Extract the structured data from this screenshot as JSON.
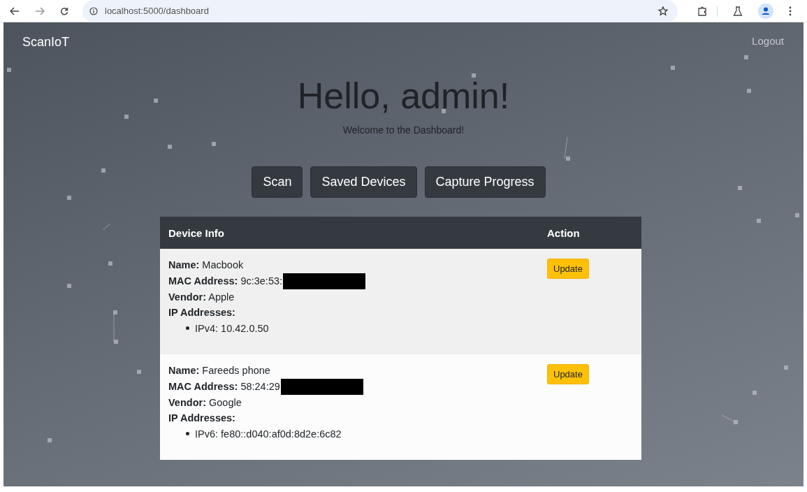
{
  "browser": {
    "url": "localhost:5000/dashboard"
  },
  "navbar": {
    "brand": "ScanIoT",
    "logout": "Logout"
  },
  "greeting": "Hello, admin!",
  "subtitle": "Welcome to the Dashboard!",
  "buttons": [
    "Scan",
    "Saved Devices",
    "Capture Progress"
  ],
  "table": {
    "columns": [
      "Device Info",
      "Action"
    ],
    "rows": [
      {
        "fields": [
          {
            "label": "Name:",
            "value": "Macbook",
            "redacted": false
          },
          {
            "label": "MAC Address:",
            "value": "9c:3e:53:",
            "redacted": true
          },
          {
            "label": "Vendor:",
            "value": "Apple",
            "redacted": false
          }
        ],
        "ip_label": "IP Addresses:",
        "ips": [
          "IPv4: 10.42.0.50"
        ],
        "action": "Update"
      },
      {
        "fields": [
          {
            "label": "Name:",
            "value": "Fareeds phone",
            "redacted": false
          },
          {
            "label": "MAC Address:",
            "value": "58:24:29",
            "redacted": true
          },
          {
            "label": "Vendor:",
            "value": "Google",
            "redacted": false
          }
        ],
        "ip_label": "IP Addresses:",
        "ips": [
          "IPv6: fe80::d040:af0d:8d2e:6c82"
        ],
        "action": "Update"
      }
    ]
  }
}
